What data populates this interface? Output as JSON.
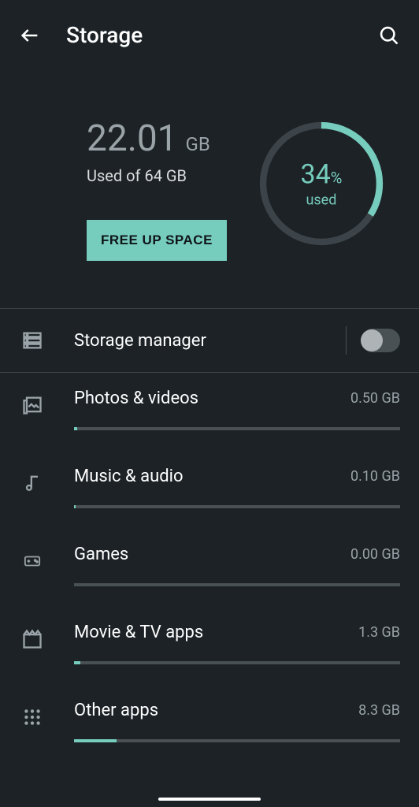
{
  "header": {
    "title": "Storage"
  },
  "summary": {
    "used_amount": "22.01",
    "used_unit": "GB",
    "used_subtitle": "Used of 64 GB",
    "free_up_label": "FREE UP SPACE",
    "percent": "34",
    "percent_symbol": "%",
    "percent_label": "used",
    "ring_fill_fraction": 0.34
  },
  "manager": {
    "label": "Storage manager",
    "enabled": false
  },
  "categories": [
    {
      "key": "photos",
      "label": "Photos & videos",
      "value": "0.50 GB",
      "fill_percent": 1
    },
    {
      "key": "music",
      "label": "Music & audio",
      "value": "0.10 GB",
      "fill_percent": 0.5
    },
    {
      "key": "games",
      "label": "Games",
      "value": "0.00 GB",
      "fill_percent": 0
    },
    {
      "key": "movies",
      "label": "Movie & TV apps",
      "value": "1.3 GB",
      "fill_percent": 2
    },
    {
      "key": "other",
      "label": "Other apps",
      "value": "8.3 GB",
      "fill_percent": 13
    }
  ],
  "colors": {
    "accent": "#76ccbd",
    "background": "#1c2226",
    "muted": "#9aa3a8"
  }
}
